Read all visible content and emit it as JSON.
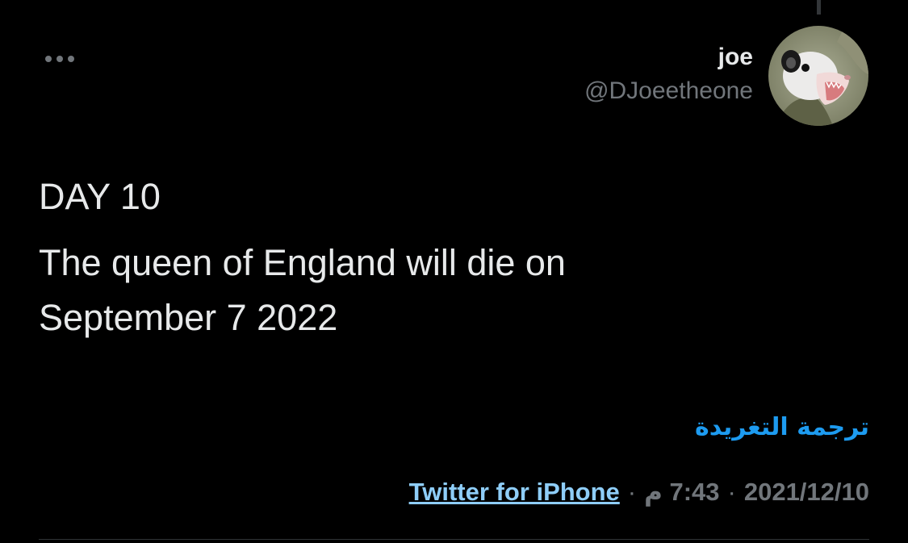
{
  "author": {
    "display_name": "joe",
    "handle": "@DJoeetheone"
  },
  "tweet": {
    "line1": "DAY 10",
    "line2": "The queen of England will die on September 7 2022"
  },
  "translate_label": "ترجمة التغريدة",
  "meta": {
    "source": "Twitter for iPhone",
    "time": "7:43 م",
    "date": "2021/12/10",
    "separator": "·"
  },
  "colors": {
    "background": "#000000",
    "text": "#e7e9ea",
    "muted": "#71767b",
    "link": "#1d9bf0",
    "source_link": "#8ecdf8"
  },
  "icons": {
    "more": "more-horizontal-icon"
  }
}
